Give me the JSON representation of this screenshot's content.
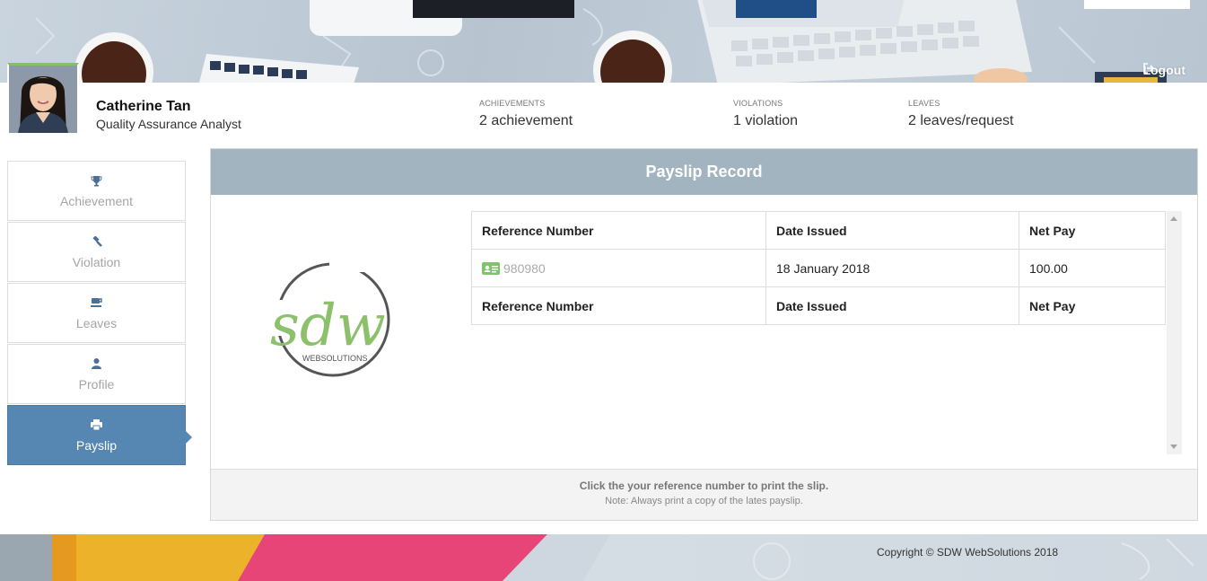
{
  "header": {
    "logout_label": "Logout"
  },
  "profile": {
    "name": "Catherine Tan",
    "role": "Quality Assurance Analyst",
    "stats": [
      {
        "label": "ACHIEVEMENTS",
        "value": "2 achievement"
      },
      {
        "label": "VIOLATIONS",
        "value": "1 violation"
      },
      {
        "label": "LEAVES",
        "value": "2 leaves/request"
      }
    ]
  },
  "sidebar": {
    "items": [
      {
        "label": "Achievement",
        "icon": "trophy-icon"
      },
      {
        "label": "Violation",
        "icon": "gavel-icon"
      },
      {
        "label": "Leaves",
        "icon": "coffee-icon"
      },
      {
        "label": "Profile",
        "icon": "user-icon"
      },
      {
        "label": "Payslip",
        "icon": "print-icon",
        "active": true
      }
    ]
  },
  "panel": {
    "title": "Payslip Record",
    "logo_text": "sdw",
    "logo_subtext": "WEBSOLUTIONS",
    "table": {
      "headers": [
        "Reference Number",
        "Date Issued",
        "Net Pay"
      ],
      "rows": [
        [
          "980980",
          "18 January 2018",
          "100.00"
        ]
      ],
      "footer_headers": [
        "Reference Number",
        "Date Issued",
        "Net Pay"
      ]
    },
    "footer_line1": "Click the your reference number to print the slip.",
    "footer_line2": "Note: Always print a copy of the lates payslip."
  },
  "footer": {
    "copyright": "Copyright © SDW WebSolutions 2018"
  },
  "colors": {
    "accent": "#5687b3",
    "panel_header": "#a3b4c1",
    "logo_green": "#8cc06a",
    "logo_gray": "#555555"
  }
}
